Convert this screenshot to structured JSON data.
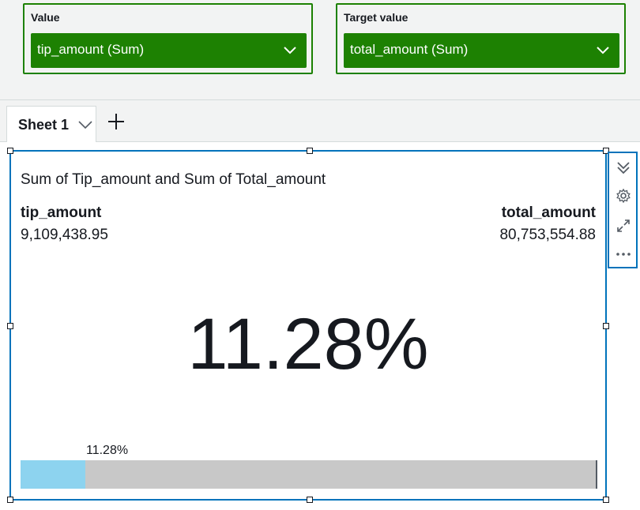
{
  "field_wells": {
    "value": {
      "label": "Value",
      "field": "tip_amount (Sum)"
    },
    "target": {
      "label": "Target value",
      "field": "total_amount (Sum)"
    }
  },
  "sheets": {
    "tabs": [
      {
        "label": "Sheet 1"
      }
    ]
  },
  "visual": {
    "title": "Sum of Tip_amount and Sum of Total_amount",
    "value_name": "tip_amount",
    "value": "9,109,438.95",
    "target_name": "total_amount",
    "target": "80,753,554.88",
    "percent_text": "11.28%",
    "progress": {
      "label": "11.28%",
      "fraction": 0.1128
    }
  },
  "colors": {
    "well_green": "#1d8102",
    "selection_blue": "#0073bb",
    "bar_fill": "#8dd3ef",
    "bar_track": "#c8c8c8"
  },
  "icons": {
    "visual_menu": [
      "collapse-icon",
      "gear-icon",
      "expand-icon",
      "more-icon"
    ]
  }
}
